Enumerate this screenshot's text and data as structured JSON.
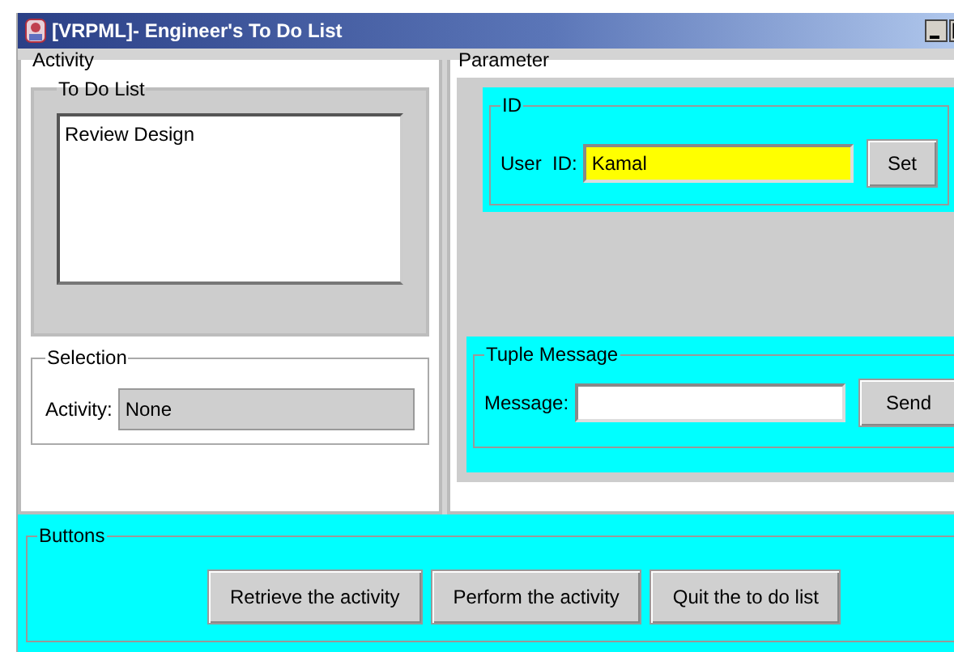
{
  "window": {
    "title": "[VRPML]- Engineer's To Do List"
  },
  "activity": {
    "legend": "Activity",
    "todo": {
      "legend": "To Do List",
      "items": [
        {
          "label": "Review Design",
          "selected": false
        }
      ]
    },
    "selection": {
      "legend": "Selection",
      "label": "Activity:",
      "value": "None"
    }
  },
  "parameter": {
    "legend": "Parameter",
    "id": {
      "legend": "ID",
      "label": "User  ID:",
      "value": "Kamal",
      "button": "Set"
    },
    "tuple": {
      "legend": "Tuple Message",
      "label": "Message:",
      "button": "Send"
    }
  },
  "buttons": {
    "legend": "Buttons",
    "items": [
      "Retrieve the activity",
      "Perform the activity",
      "Quit the to do list"
    ]
  }
}
